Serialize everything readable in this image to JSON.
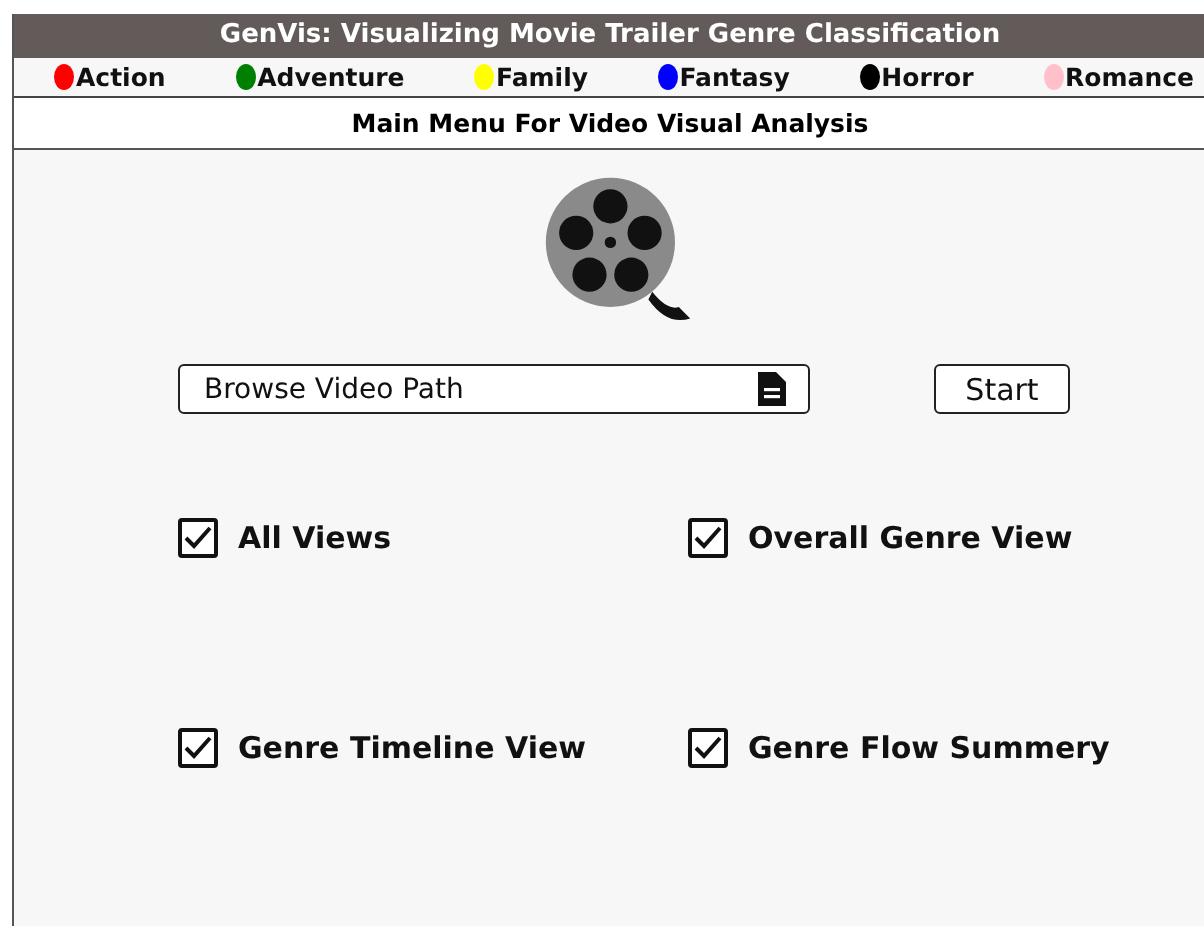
{
  "window": {
    "title": "GenVis: Visualizing Movie Trailer Genre Classification"
  },
  "legend": [
    {
      "label": "Action",
      "color": "#ff0000"
    },
    {
      "label": "Adventure",
      "color": "#008000"
    },
    {
      "label": "Family",
      "color": "#ffff00"
    },
    {
      "label": "Fantasy",
      "color": "#0000ff"
    },
    {
      "label": "Horror",
      "color": "#000000"
    },
    {
      "label": "Romance",
      "color": "#ffc0cb"
    }
  ],
  "header": "Main Menu For Video Visual Analysis",
  "browse": {
    "placeholder": "Browse Video Path"
  },
  "start_button": "Start",
  "views": [
    {
      "label": "All Views",
      "checked": true
    },
    {
      "label": "Overall Genre View",
      "checked": true
    },
    {
      "label": "Genre Timeline View",
      "checked": true
    },
    {
      "label": "Genre Flow Summery",
      "checked": true
    }
  ]
}
